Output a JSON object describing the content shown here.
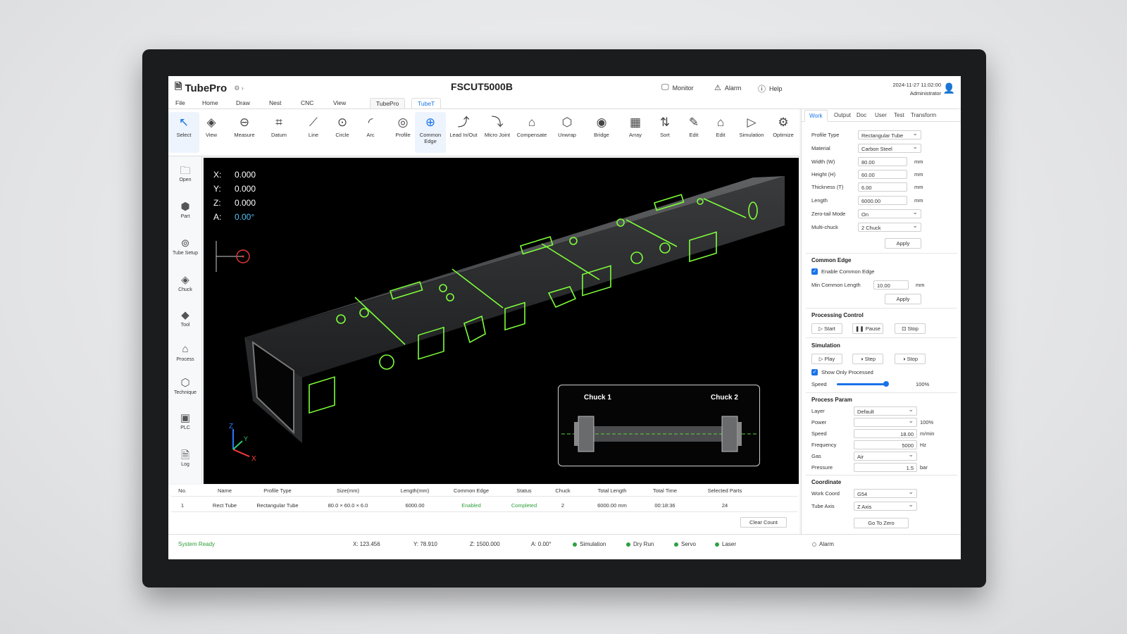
{
  "app": {
    "name": "TubePro",
    "machine": "FSCUT5000B",
    "datetime": "2024-11-27 11:02:00",
    "user": "Administrator"
  },
  "titlebar": {
    "monitor": "Monitor",
    "alarm": "Alarm",
    "help": "Help"
  },
  "menu": [
    "File",
    "Home",
    "Draw",
    "Nest",
    "CNC",
    "View"
  ],
  "menu_tabs": [
    "TubePro",
    "TubeT"
  ],
  "ribbon": [
    "Select",
    "View",
    "Measure",
    "Datum",
    "Line",
    "Circle",
    "Arc",
    "Profile",
    "Common Edge",
    "Lead In/Out",
    "Micro Joint",
    "Compensate",
    "Unwrap",
    "Bridge",
    "Array",
    "Sort",
    "Edit",
    "Edit",
    "Simulation",
    "Optimize"
  ],
  "leftbar": [
    "Open",
    "Part",
    "Tube Setup",
    "Chuck",
    "Tool",
    "Process",
    "Technique",
    "PLC",
    "Log"
  ],
  "viewport": {
    "x": "0.000",
    "y": "0.000",
    "z": "0.000",
    "a": "0.00°",
    "chuck1": "Chuck 1",
    "chuck2": "Chuck 2"
  },
  "right_tabs": [
    "Work",
    "Output",
    "Doc",
    "User",
    "Test",
    "Transform"
  ],
  "work": {
    "profile_type_label": "Profile Type",
    "profile_type": "Rectangular Tube",
    "material_label": "Material",
    "material": "Carbon Steel",
    "width_label": "Width (W)",
    "width": "80.00",
    "height_label": "Height (H)",
    "height": "60.00",
    "thickness_label": "Thickness (T)",
    "thickness": "6.00",
    "length_label": "Length",
    "length": "6000.00",
    "zero_tail_label": "Zero-tail Mode",
    "zero_tail": "On",
    "multi_chuck_label": "Multi-chuck",
    "multi_chuck": "2 Chuck",
    "unit": "mm",
    "apply": "Apply"
  },
  "common_edge": {
    "title": "Common Edge",
    "enable": "Enable Common Edge",
    "min_label": "Min Common Length",
    "min": "10.00",
    "unit": "mm",
    "apply": "Apply"
  },
  "processing": {
    "title": "Processing Control",
    "start": "Start",
    "pause": "Pause",
    "stop": "Stop"
  },
  "simulation": {
    "title": "Simulation",
    "play": "Play",
    "step": "Step",
    "stop": "Stop",
    "show_only": "Show Only Processed",
    "speed_label": "Speed",
    "speed": "100%",
    "speed_fraction": 1.0
  },
  "process_param": {
    "title": "Process Param",
    "layer_label": "Layer",
    "layer": "Default",
    "power_label": "Power",
    "power": "",
    "power_unit": "100%",
    "speed_label": "Speed",
    "speed": "18.00",
    "speed_unit": "m/min",
    "freq_label": "Frequency",
    "freq": "5000",
    "freq_unit": "Hz",
    "gas_label": "Gas",
    "gas": "Air",
    "pressure_label": "Pressure",
    "pressure": "1.5",
    "pressure_unit": "bar"
  },
  "coordinate": {
    "title": "Coordinate",
    "work_label": "Work Coord",
    "work": "G54",
    "axis_label": "Tube Axis",
    "axis": "Z Axis",
    "go_zero": "Go To Zero"
  },
  "table": {
    "headers": [
      "No.",
      "Name",
      "Profile Type",
      "Size(mm)",
      "Length(mm)",
      "Common Edge",
      "Status",
      "Chuck",
      "Total Length",
      "Total Time",
      "Selected Parts"
    ],
    "row": [
      "1",
      "Rect Tube",
      "Rectangular Tube",
      "80.0 × 60.0 × 6.0",
      "6000.00",
      "Enabled",
      "Completed",
      "2",
      "6000.00 mm",
      "00:18:36",
      "24"
    ],
    "clear": "Clear Count"
  },
  "status": {
    "ready": "System Ready",
    "x": "X:  123.456",
    "y": "Y:  78.910",
    "z": "Z:  1500.000",
    "a": "A:  0.00°",
    "sim": "Simulation",
    "dry": "Dry Run",
    "servo": "Servo",
    "laser": "Laser",
    "alarm": "Alarm"
  },
  "colors": {
    "accent": "#1a73e8",
    "ok": "#2ea043",
    "cut": "#7dff3a"
  }
}
